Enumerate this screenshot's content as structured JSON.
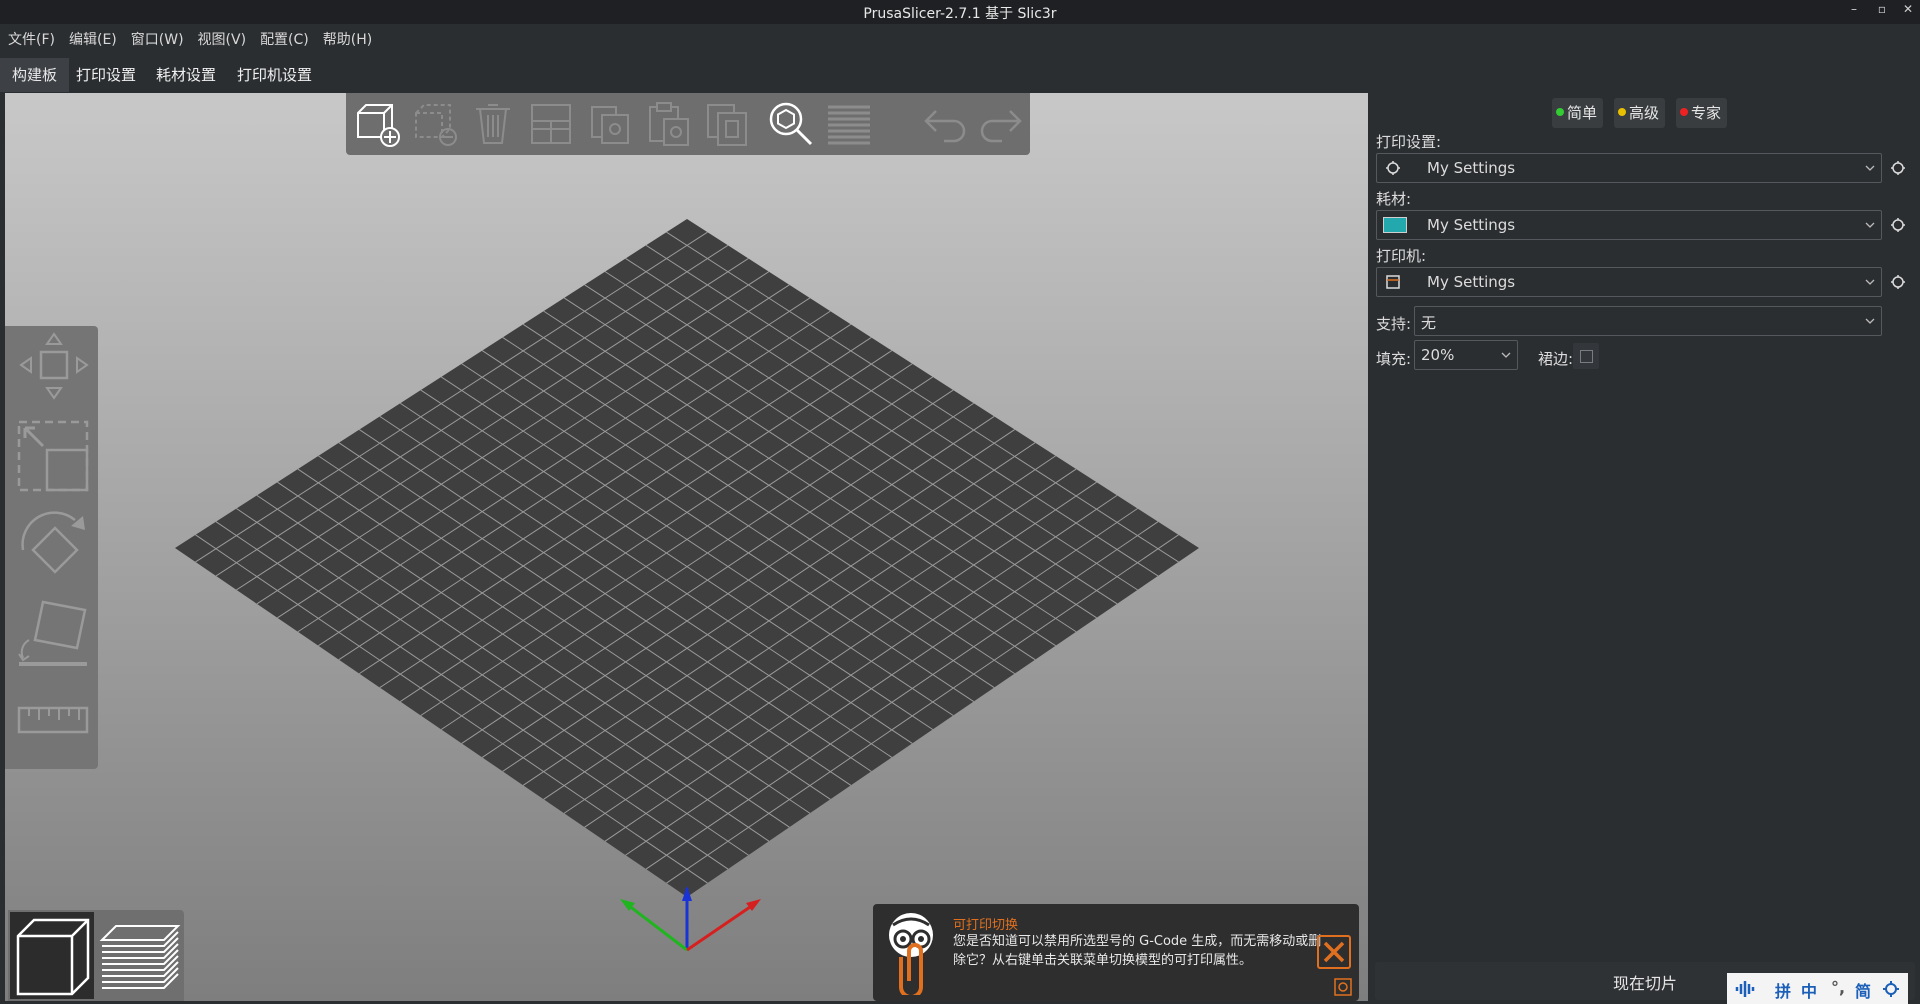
{
  "window": {
    "title": "PrusaSlicer-2.7.1 基于 Slic3r",
    "btn_min": "–",
    "btn_max": "▫",
    "btn_close": "✕"
  },
  "menu": [
    "文件(F)",
    "编辑(E)",
    "窗口(W)",
    "视图(V)",
    "配置(C)",
    "帮助(H)"
  ],
  "tabs": [
    "构建板",
    "打印设置",
    "耗材设置",
    "打印机设置"
  ],
  "active_tab": "构建板",
  "modes": [
    {
      "label": "简单",
      "color": "#33cc33"
    },
    {
      "label": "高级",
      "color": "#e8c000"
    },
    {
      "label": "专家",
      "color": "#ee2222"
    }
  ],
  "print_settings": {
    "label": "打印设置:",
    "value": "My Settings"
  },
  "filament": {
    "label": "耗材:",
    "value": "My Settings",
    "swatch_color": "#22a8ad"
  },
  "printer": {
    "label": "打印机:",
    "value": "My Settings"
  },
  "support": {
    "label": "支持:",
    "value": "无"
  },
  "infill": {
    "label": "填充:",
    "value": "20%"
  },
  "brim": {
    "label": "裙边:",
    "checked": false
  },
  "slice_button": "现在切片",
  "notification": {
    "title": "可打印切换",
    "body": "您是否知道可以禁用所选型号的 G-Code 生成，而无需移动或删除它？从右键单击关联菜单切换模型的可打印属性。"
  },
  "toolbar_icons": [
    "add-icon",
    "delete-icon",
    "delete-all-icon",
    "arrange-icon",
    "copy-icon",
    "paste-icon",
    "instance-icon",
    "search-icon",
    "layers-icon",
    "undo-icon",
    "redo-icon"
  ],
  "left_gizmos": [
    "move-icon",
    "scale-icon",
    "rotate-icon",
    "place-on-face-icon",
    "measure-icon"
  ],
  "ime": {
    "pin": "拼",
    "zhong": "中",
    "jian": "简"
  },
  "colors": {
    "accent": "#e0701f",
    "plate": "#3f3f3f",
    "grid": "#9a9a9a"
  }
}
